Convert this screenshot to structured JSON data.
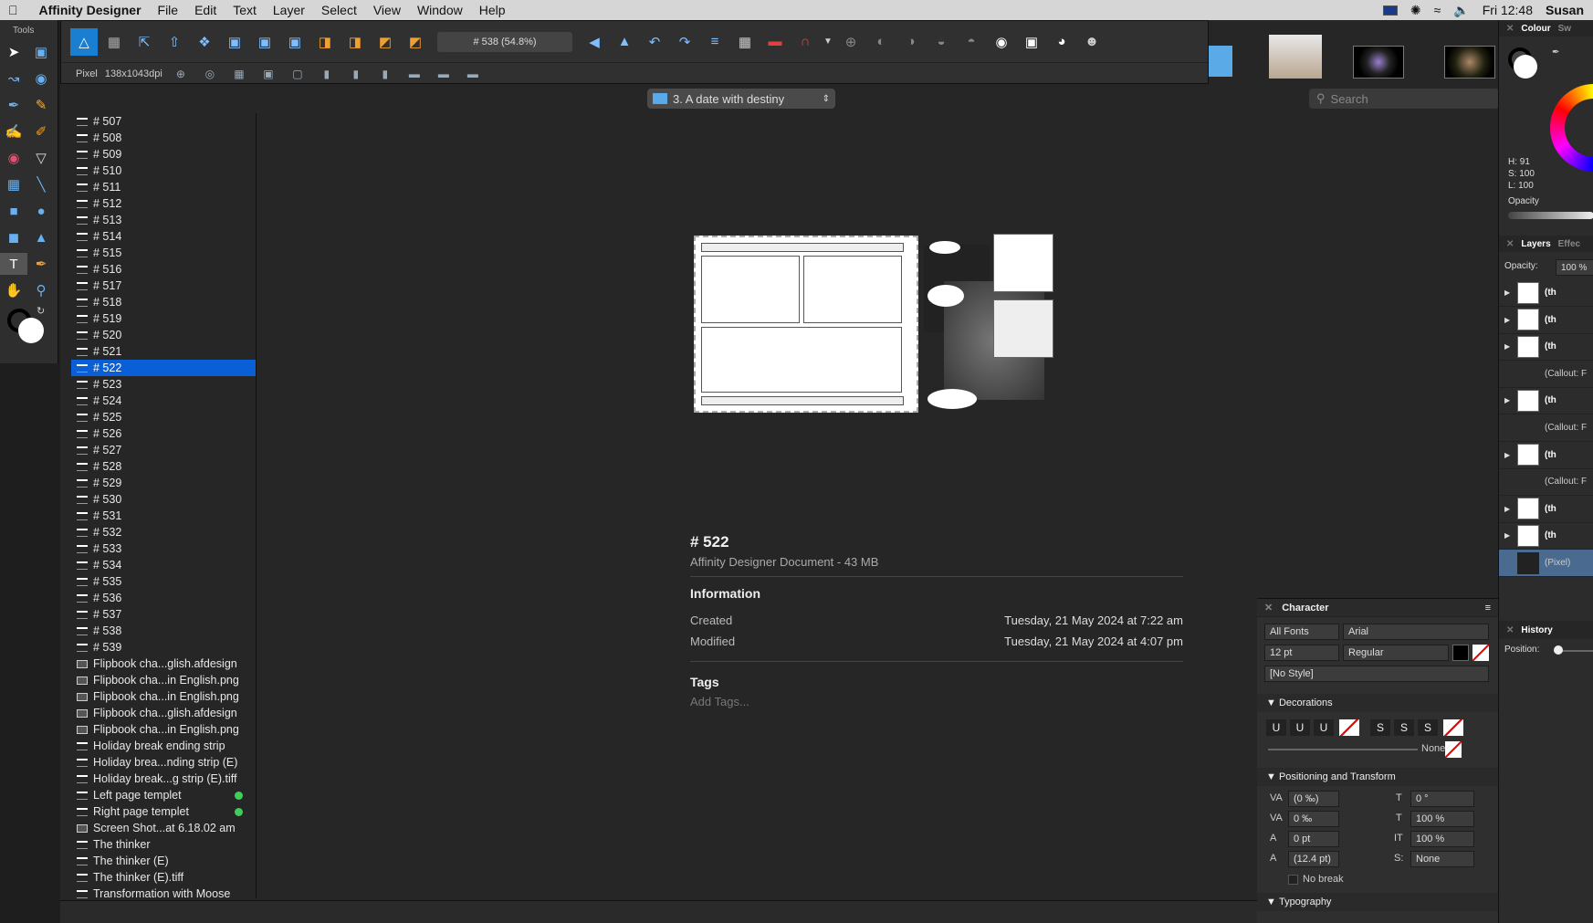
{
  "menubar": {
    "app": "Affinity Designer",
    "items": [
      "File",
      "Edit",
      "Text",
      "Layer",
      "Select",
      "View",
      "Window",
      "Help"
    ],
    "clock": "Fri 12:48",
    "user": "Susan"
  },
  "tools_panel": {
    "title": "Tools"
  },
  "toolbar": {
    "zoom_label": "# 538 (54.8%)",
    "unit": "Pixel",
    "doc_size": "138x1043dpi"
  },
  "pathbar": {
    "label": "3. A date with destiny"
  },
  "search": {
    "placeholder": "Search"
  },
  "file_list": {
    "items": [
      {
        "label": "# 507",
        "icon": "doc-icon"
      },
      {
        "label": "# 508",
        "icon": "doc-icon"
      },
      {
        "label": "# 509",
        "icon": "doc-icon"
      },
      {
        "label": "# 510",
        "icon": "doc-icon"
      },
      {
        "label": "# 511",
        "icon": "doc-icon"
      },
      {
        "label": "# 512",
        "icon": "doc-icon"
      },
      {
        "label": "# 513",
        "icon": "doc-icon"
      },
      {
        "label": "# 514",
        "icon": "doc-icon"
      },
      {
        "label": "# 515",
        "icon": "doc-icon"
      },
      {
        "label": "# 516",
        "icon": "doc-icon"
      },
      {
        "label": "# 517",
        "icon": "doc-icon"
      },
      {
        "label": "# 518",
        "icon": "doc-icon"
      },
      {
        "label": "# 519",
        "icon": "doc-icon"
      },
      {
        "label": "# 520",
        "icon": "doc-icon"
      },
      {
        "label": "# 521",
        "icon": "doc-icon"
      },
      {
        "label": "# 522",
        "icon": "doc-icon",
        "selected": true
      },
      {
        "label": "# 523",
        "icon": "doc-icon"
      },
      {
        "label": "# 524",
        "icon": "doc-icon"
      },
      {
        "label": "# 525",
        "icon": "doc-icon"
      },
      {
        "label": "# 526",
        "icon": "doc-icon"
      },
      {
        "label": "# 527",
        "icon": "doc-icon"
      },
      {
        "label": "# 528",
        "icon": "doc-icon"
      },
      {
        "label": "# 529",
        "icon": "doc-icon"
      },
      {
        "label": "# 530",
        "icon": "doc-icon"
      },
      {
        "label": "# 531",
        "icon": "doc-icon"
      },
      {
        "label": "# 532",
        "icon": "doc-icon"
      },
      {
        "label": "# 533",
        "icon": "doc-icon"
      },
      {
        "label": "# 534",
        "icon": "doc-icon"
      },
      {
        "label": "# 535",
        "icon": "doc-icon"
      },
      {
        "label": "# 536",
        "icon": "doc-icon"
      },
      {
        "label": "# 537",
        "icon": "doc-icon"
      },
      {
        "label": "# 538",
        "icon": "doc-icon"
      },
      {
        "label": "# 539",
        "icon": "doc-icon"
      },
      {
        "label": "Flipbook cha...glish.afdesign",
        "icon": "image-icon"
      },
      {
        "label": "Flipbook cha...in English.png",
        "icon": "image-icon"
      },
      {
        "label": "Flipbook cha...in English.png",
        "icon": "image-icon"
      },
      {
        "label": "Flipbook cha...glish.afdesign",
        "icon": "image-icon"
      },
      {
        "label": "Flipbook cha...in English.png",
        "icon": "image-icon"
      },
      {
        "label": "Holiday break ending strip",
        "icon": "doc-icon"
      },
      {
        "label": "Holiday brea...nding strip (E)",
        "icon": "doc-icon"
      },
      {
        "label": "Holiday break...g strip (E).tiff",
        "icon": "doc-icon"
      },
      {
        "label": "Left page templet",
        "icon": "doc-icon",
        "tag": "#3ecf5a"
      },
      {
        "label": "Right page templet",
        "icon": "doc-icon",
        "tag": "#3ecf5a"
      },
      {
        "label": "Screen Shot...at 6.18.02 am",
        "icon": "image-icon"
      },
      {
        "label": "The thinker",
        "icon": "doc-icon"
      },
      {
        "label": "The thinker (E)",
        "icon": "doc-icon"
      },
      {
        "label": "The thinker (E).tiff",
        "icon": "doc-icon"
      },
      {
        "label": "Transformation with Moose",
        "icon": "doc-icon"
      }
    ]
  },
  "info": {
    "title": "# 522",
    "subtitle": "Affinity Designer Document - 43 MB",
    "section": "Information",
    "created_label": "Created",
    "created_value": "Tuesday, 21 May 2024 at 7:22 am",
    "modified_label": "Modified",
    "modified_value": "Tuesday, 21 May 2024 at 4:07 pm",
    "tags_label": "Tags",
    "tags_placeholder": "Add Tags..."
  },
  "character": {
    "title": "Character",
    "font_collection": "All Fonts",
    "font": "Arial",
    "size": "12 pt",
    "weight": "Regular",
    "style": "[No Style]",
    "decorations_label": "Decorations",
    "deco_none": "None",
    "pos_label": "Positioning and Transform",
    "kern": "(0 ‰)",
    "track": "0 ‰",
    "baseline": "0 pt",
    "leading": "(12.4 pt)",
    "skew": "0 °",
    "vscale": "100 %",
    "hscale": "100 %",
    "shear": "None",
    "nobreak": "No break",
    "typography_label": "Typography"
  },
  "right_panel": {
    "colour_tab": "Colour",
    "swatch_tab": "Sw",
    "h": "H: 91",
    "s": "S: 100",
    "l": "L: 100",
    "opacity_label": "Opacity",
    "layers_tab": "Layers",
    "effects_tab": "Effec",
    "layer_opacity_label": "Opacity:",
    "layer_opacity": "100 %",
    "layers": [
      {
        "name": "(th",
        "kind": "text"
      },
      {
        "name": "(th",
        "kind": "text"
      },
      {
        "name": "(th",
        "kind": "text"
      },
      {
        "name": "(Callout: F",
        "kind": "callout"
      },
      {
        "name": "(th",
        "kind": "text"
      },
      {
        "name": "(Callout: F",
        "kind": "callout"
      },
      {
        "name": "(th",
        "kind": "text"
      },
      {
        "name": "(Callout: F",
        "kind": "callout"
      },
      {
        "name": "(th",
        "kind": "text"
      },
      {
        "name": "(th",
        "kind": "text"
      },
      {
        "name": "(Pixel)",
        "kind": "pixel"
      }
    ],
    "history_tab": "History",
    "position_label": "Position:"
  }
}
